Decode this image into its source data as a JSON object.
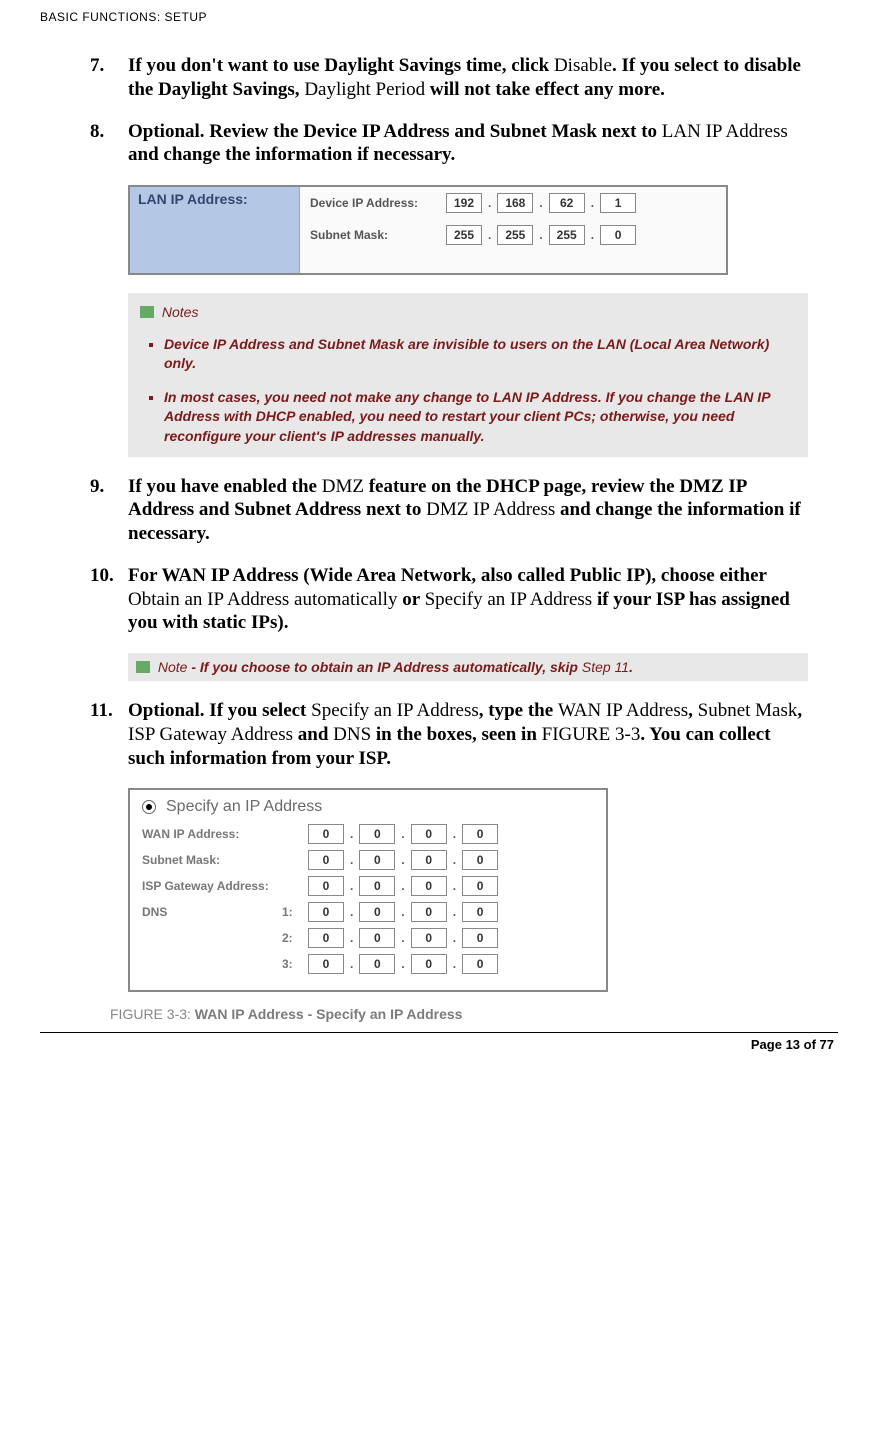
{
  "header": "BASIC FUNCTIONS: SETUP",
  "steps": {
    "s7": {
      "num": "7.",
      "parts": [
        {
          "b": true,
          "t": "If you don't want to use Daylight Savings time, click "
        },
        {
          "b": false,
          "t": "Disable"
        },
        {
          "b": true,
          "t": ". If you select to disable the Daylight Savings, "
        },
        {
          "b": false,
          "t": "Daylight Period "
        },
        {
          "b": true,
          "t": "will not take effect any more."
        }
      ]
    },
    "s8": {
      "num": "8.",
      "parts": [
        {
          "b": true,
          "t": "Optional. Review the Device IP Address and Subnet Mask next to "
        },
        {
          "b": false,
          "t": "LAN IP Address "
        },
        {
          "b": true,
          "t": "and change the information if necessary."
        }
      ]
    },
    "s9": {
      "num": "9.",
      "parts": [
        {
          "b": true,
          "t": "If you have enabled the "
        },
        {
          "b": false,
          "t": "DMZ "
        },
        {
          "b": true,
          "t": "feature on the DHCP page, review the DMZ IP Address and Subnet Address next to "
        },
        {
          "b": false,
          "t": "DMZ IP Address "
        },
        {
          "b": true,
          "t": "and change the information if necessary."
        }
      ]
    },
    "s10": {
      "num": "10.",
      "parts": [
        {
          "b": true,
          "t": "For WAN IP Address (Wide Area Network, also called Public IP), choose either "
        },
        {
          "b": false,
          "t": "Obtain an IP Address automatically "
        },
        {
          "b": true,
          "t": "or "
        },
        {
          "b": false,
          "t": "Specify an IP Address "
        },
        {
          "b": true,
          "t": "if your ISP has assigned you with static IPs)."
        }
      ]
    },
    "s11": {
      "num": "11.",
      "parts": [
        {
          "b": true,
          "t": "Optional. If you select "
        },
        {
          "b": false,
          "t": "Specify an IP Address"
        },
        {
          "b": true,
          "t": ", type the "
        },
        {
          "b": false,
          "t": "WAN IP Address"
        },
        {
          "b": true,
          "t": ", "
        },
        {
          "b": false,
          "t": "Subnet Mask"
        },
        {
          "b": true,
          "t": ", "
        },
        {
          "b": false,
          "t": "ISP Gateway Address "
        },
        {
          "b": true,
          "t": "and "
        },
        {
          "b": false,
          "t": "DNS "
        },
        {
          "b": true,
          "t": "in the boxes, seen in "
        },
        {
          "b": false,
          "t": "FIGURE 3-3"
        },
        {
          "b": true,
          "t": ". You can collect such information from your ISP."
        }
      ]
    }
  },
  "lanip": {
    "panel_label": "LAN IP Address:",
    "row1_label": "Device IP Address:",
    "row1_vals": [
      "192",
      "168",
      "62",
      "1"
    ],
    "row2_label": "Subnet Mask:",
    "row2_vals": [
      "255",
      "255",
      "255",
      "0"
    ]
  },
  "notes_box": {
    "title": "Notes",
    "items": [
      "Device IP Address and Subnet Mask are invisible to users on the LAN (Local Area Network) only.",
      "In most cases, you need not make any change to LAN IP Address. If you change the LAN IP Address with DHCP enabled, you need to restart your client PCs; otherwise, you need reconfigure your client's IP addresses manually."
    ]
  },
  "note_single": {
    "label": "Note",
    "body_bold1": " - If you choose to obtain an IP Address automatically, skip ",
    "step": "Step 11",
    "period": "."
  },
  "wan": {
    "title": "Specify an IP Address",
    "rows": [
      {
        "label": "WAN IP Address:",
        "vals": [
          "0",
          "0",
          "0",
          "0"
        ]
      },
      {
        "label": "Subnet Mask:",
        "vals": [
          "0",
          "0",
          "0",
          "0"
        ]
      },
      {
        "label": "ISP Gateway Address:",
        "vals": [
          "0",
          "0",
          "0",
          "0"
        ]
      }
    ],
    "dns_label": "DNS",
    "dns": [
      {
        "idx": "1:",
        "vals": [
          "0",
          "0",
          "0",
          "0"
        ]
      },
      {
        "idx": "2:",
        "vals": [
          "0",
          "0",
          "0",
          "0"
        ]
      },
      {
        "idx": "3:",
        "vals": [
          "0",
          "0",
          "0",
          "0"
        ]
      }
    ]
  },
  "figure_caption": {
    "prefix": "FIGURE 3-3: ",
    "title": "WAN IP Address - Specify an IP Address"
  },
  "footer": "Page 13 of 77"
}
